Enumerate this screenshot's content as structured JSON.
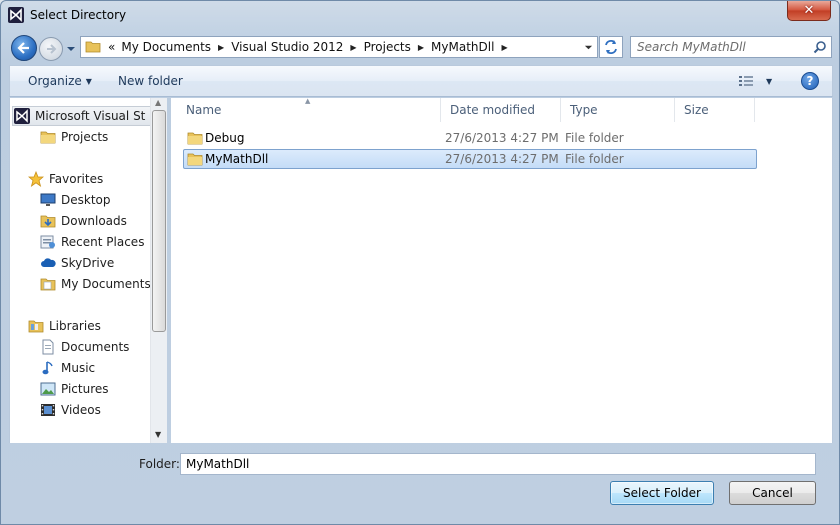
{
  "window": {
    "title": "Select Directory"
  },
  "address": {
    "overflow": "«",
    "crumbs": [
      "My Documents",
      "Visual Studio 2012",
      "Projects",
      "MyMathDll"
    ]
  },
  "search": {
    "placeholder": "Search MyMathDll"
  },
  "toolbar": {
    "organize": "Organize",
    "new_folder": "New folder",
    "help": "?"
  },
  "nav": {
    "items": [
      {
        "label": "Microsoft Visual St",
        "icon": "vs-logo-icon"
      },
      {
        "label": "Projects",
        "icon": "folder-icon"
      },
      {
        "label": "Favorites",
        "icon": "star-icon"
      },
      {
        "label": "Desktop",
        "icon": "desktop-icon"
      },
      {
        "label": "Downloads",
        "icon": "downloads-icon"
      },
      {
        "label": "Recent Places",
        "icon": "recent-places-icon"
      },
      {
        "label": "SkyDrive",
        "icon": "skydrive-icon"
      },
      {
        "label": "My Documents",
        "icon": "documents-folder-icon"
      },
      {
        "label": "Libraries",
        "icon": "libraries-icon"
      },
      {
        "label": "Documents",
        "icon": "document-icon"
      },
      {
        "label": "Music",
        "icon": "music-icon"
      },
      {
        "label": "Pictures",
        "icon": "pictures-icon"
      },
      {
        "label": "Videos",
        "icon": "videos-icon"
      }
    ]
  },
  "list": {
    "columns": [
      "Name",
      "Date modified",
      "Type",
      "Size"
    ],
    "rows": [
      {
        "name": "Debug",
        "date": "27/6/2013 4:27 PM",
        "type": "File folder",
        "size": ""
      },
      {
        "name": "MyMathDll",
        "date": "27/6/2013 4:27 PM",
        "type": "File folder",
        "size": ""
      }
    ],
    "selected_index": 1
  },
  "footer": {
    "folder_label": "Folder:",
    "folder_value": "MyMathDll",
    "select_button": "Select Folder",
    "cancel_button": "Cancel"
  },
  "colors": {
    "accent": "#3c7fb1",
    "selection": "#c4dcf7",
    "close": "#c13d24"
  }
}
